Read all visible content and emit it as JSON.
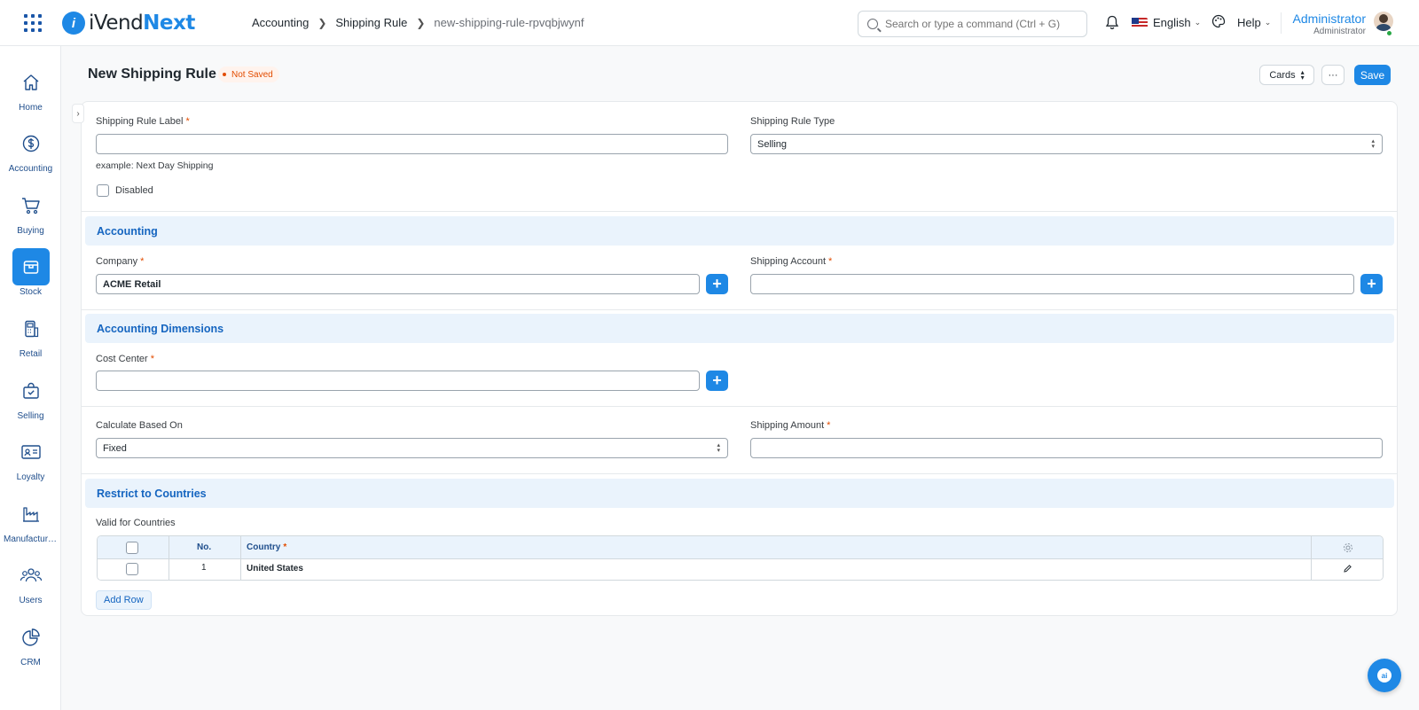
{
  "navbar": {
    "logo_prefix": "iVend",
    "logo_suffix": "Next",
    "breadcrumb": [
      "Accounting",
      "Shipping Rule",
      "new-shipping-rule-rpvqbjwynf"
    ],
    "search_placeholder": "Search or type a command (Ctrl + G)",
    "language": "English",
    "help": "Help",
    "user_name": "Administrator",
    "user_role": "Administrator"
  },
  "sidebar": {
    "items": [
      {
        "label": "Home",
        "icon": "home-icon"
      },
      {
        "label": "Accounting",
        "icon": "dollar-icon"
      },
      {
        "label": "Buying",
        "icon": "cart-icon"
      },
      {
        "label": "Stock",
        "icon": "box-icon"
      },
      {
        "label": "Retail",
        "icon": "pos-terminal-icon"
      },
      {
        "label": "Selling",
        "icon": "shopping-bag-icon"
      },
      {
        "label": "Loyalty",
        "icon": "id-card-icon"
      },
      {
        "label": "Manufacturing",
        "icon": "factory-icon"
      },
      {
        "label": "Users",
        "icon": "users-icon"
      },
      {
        "label": "CRM",
        "icon": "pie-chart-icon"
      }
    ]
  },
  "page": {
    "title": "New Shipping Rule",
    "status": "Not Saved",
    "view_button": "Cards",
    "more_button": "···",
    "save_button": "Save"
  },
  "form": {
    "shipping_rule_label": {
      "label": "Shipping Rule Label",
      "value": "",
      "hint": "example: Next Day Shipping"
    },
    "shipping_rule_type": {
      "label": "Shipping Rule Type",
      "value": "Selling"
    },
    "disabled": {
      "label": "Disabled"
    },
    "section_accounting": "Accounting",
    "company": {
      "label": "Company",
      "value": "ACME Retail"
    },
    "shipping_account": {
      "label": "Shipping Account",
      "value": ""
    },
    "section_dimensions": "Accounting Dimensions",
    "cost_center": {
      "label": "Cost Center",
      "value": ""
    },
    "calculate_based_on": {
      "label": "Calculate Based On",
      "value": "Fixed"
    },
    "shipping_amount": {
      "label": "Shipping Amount",
      "value": ""
    },
    "section_countries": "Restrict to Countries",
    "valid_for_countries": "Valid for Countries",
    "table": {
      "headers": {
        "no": "No.",
        "country": "Country"
      },
      "rows": [
        {
          "no": "1",
          "country": "United States"
        }
      ]
    },
    "add_row": "Add Row"
  },
  "ai_button": "ai",
  "colors": {
    "accent": "#1e88e5",
    "status": "#e24c00",
    "section_bg": "#eaf3fc"
  }
}
